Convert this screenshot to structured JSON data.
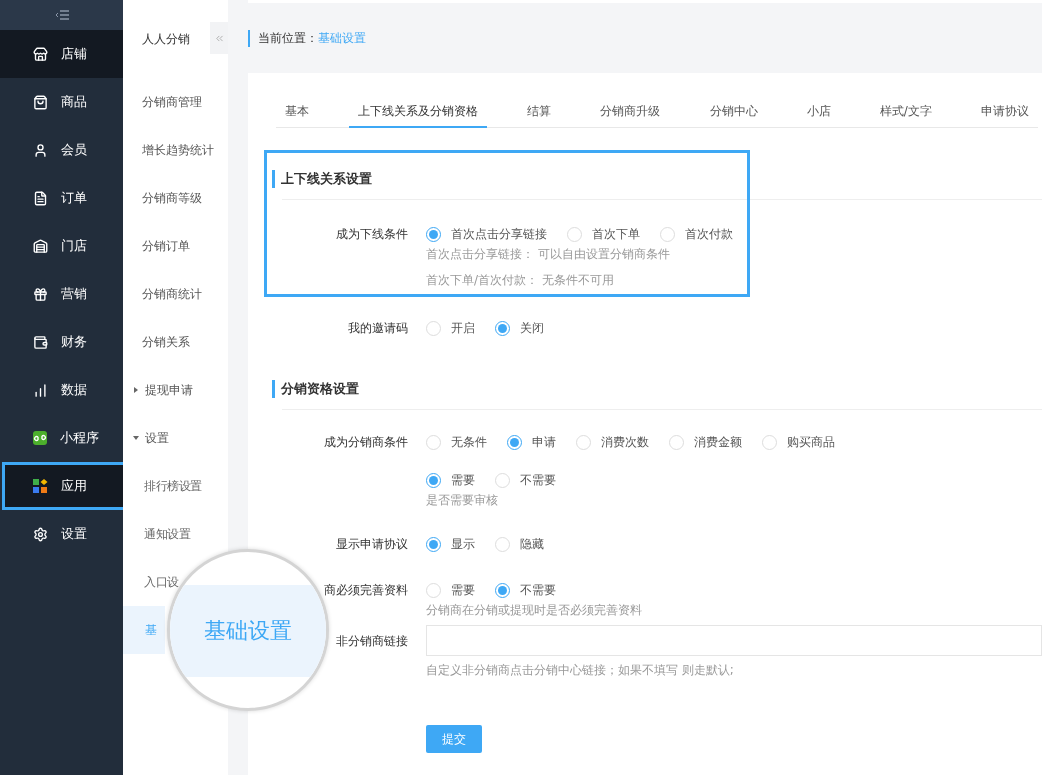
{
  "sidebar": {
    "items": [
      {
        "label": "店铺",
        "selected": true,
        "highlighted": false
      },
      {
        "label": "商品",
        "selected": false,
        "highlighted": false
      },
      {
        "label": "会员",
        "selected": false,
        "highlighted": false
      },
      {
        "label": "订单",
        "selected": false,
        "highlighted": false
      },
      {
        "label": "门店",
        "selected": false,
        "highlighted": false
      },
      {
        "label": "营销",
        "selected": false,
        "highlighted": false
      },
      {
        "label": "财务",
        "selected": false,
        "highlighted": false
      },
      {
        "label": "数据",
        "selected": false,
        "highlighted": false
      },
      {
        "label": "小程序",
        "selected": false,
        "highlighted": false
      },
      {
        "label": "应用",
        "selected": true,
        "highlighted": true
      },
      {
        "label": "设置",
        "selected": false,
        "highlighted": false
      }
    ]
  },
  "submenu": {
    "title": "人人分销",
    "items": [
      {
        "label": "分销商管理",
        "selected": false
      },
      {
        "label": "增长趋势统计",
        "selected": false
      },
      {
        "label": "分销商等级",
        "selected": false
      },
      {
        "label": "分销订单",
        "selected": false
      },
      {
        "label": "分销商统计",
        "selected": false
      },
      {
        "label": "分销关系",
        "selected": false
      },
      {
        "label": "提现申请",
        "selected": false,
        "expanded": false
      },
      {
        "label": "设置",
        "selected": false,
        "expanded": true,
        "children": [
          {
            "label": "排行榜设置",
            "selected": false
          },
          {
            "label": "通知设置",
            "selected": false
          },
          {
            "label": "入口设",
            "selected": false
          },
          {
            "label": "基",
            "selected": true
          }
        ]
      }
    ]
  },
  "breadcrumb": {
    "label": "当前位置：",
    "current": "基础设置"
  },
  "tabs": [
    {
      "label": "基本",
      "selected": false
    },
    {
      "label": "上下线关系及分销资格",
      "selected": true
    },
    {
      "label": "结算",
      "selected": false
    },
    {
      "label": "分销商升级",
      "selected": false
    },
    {
      "label": "分销中心",
      "selected": false
    },
    {
      "label": "小店",
      "selected": false
    },
    {
      "label": "样式/文字",
      "selected": false
    },
    {
      "label": "申请协议",
      "selected": false
    }
  ],
  "sections": [
    {
      "title": "上下线关系设置",
      "highlighted": true,
      "rows": [
        {
          "kind": "radio",
          "label": "成为下线条件",
          "groups": [
            {
              "options": [
                {
                  "label": "首次点击分享链接",
                  "selected": true
                },
                {
                  "label": "首次下单",
                  "selected": false
                },
                {
                  "label": "首次付款",
                  "selected": false
                }
              ],
              "hints": [
                "首次点击分享链接： 可以自由设置分销商条件",
                "首次下单/首次付款： 无条件不可用"
              ]
            }
          ]
        }
      ],
      "after": [
        {
          "kind": "radio",
          "label": "我的邀请码",
          "groups": [
            {
              "options": [
                {
                  "label": "开启",
                  "selected": false
                },
                {
                  "label": "关闭",
                  "selected": true
                }
              ]
            }
          ]
        }
      ]
    },
    {
      "title": "分销资格设置",
      "highlighted": false,
      "rows": [
        {
          "kind": "radio",
          "label": "成为分销商条件",
          "groups": [
            {
              "options": [
                {
                  "label": "无条件",
                  "selected": false
                },
                {
                  "label": "申请",
                  "selected": true
                },
                {
                  "label": "消费次数",
                  "selected": false
                },
                {
                  "label": "消费金额",
                  "selected": false
                },
                {
                  "label": "购买商品",
                  "selected": false
                }
              ]
            },
            {
              "options": [
                {
                  "label": "需要",
                  "selected": true
                },
                {
                  "label": "不需要",
                  "selected": false
                }
              ],
              "hints": [
                "是否需要审核"
              ]
            }
          ]
        },
        {
          "kind": "radio",
          "label": "显示申请协议",
          "groups": [
            {
              "options": [
                {
                  "label": "显示",
                  "selected": true
                },
                {
                  "label": "隐藏",
                  "selected": false
                }
              ]
            }
          ]
        },
        {
          "kind": "radio",
          "label": "商必须完善资料",
          "groups": [
            {
              "options": [
                {
                  "label": "需要",
                  "selected": false
                },
                {
                  "label": "不需要",
                  "selected": true
                }
              ],
              "hints": [
                "分销商在分销或提现时是否必须完善资料"
              ]
            }
          ]
        },
        {
          "kind": "input",
          "label": "非分销商链接",
          "hints": [
            "自定义非分销商点击分销中心链接；如果不填写 则走默认;"
          ]
        }
      ]
    }
  ],
  "submit": "提交",
  "magnifier": {
    "text": "基础设置"
  }
}
